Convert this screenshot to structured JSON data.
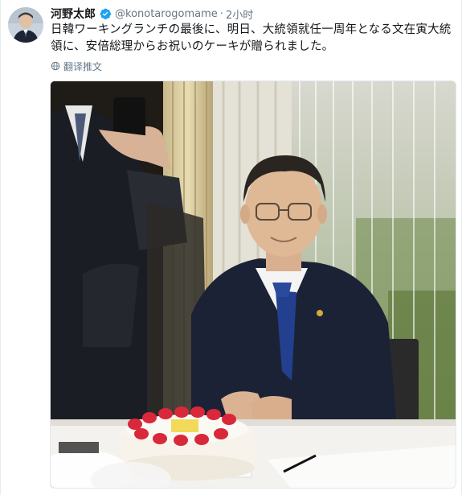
{
  "tweet": {
    "author_name": "河野太郎",
    "handle": "@konotarogomame",
    "separator": "·",
    "time": "2小时",
    "text": "日韓ワーキングランチの最後に、明日、大統領就任一周年となる文在寅大統領に、安倍総理からお祝いのケーキが贈られました。",
    "translate_label": "翻译推文",
    "verified": true
  },
  "icons": {
    "verified": "verified-badge-icon",
    "translate": "globe-icon"
  },
  "colors": {
    "verified_blue": "#1da1f2",
    "secondary_text": "#657786"
  }
}
